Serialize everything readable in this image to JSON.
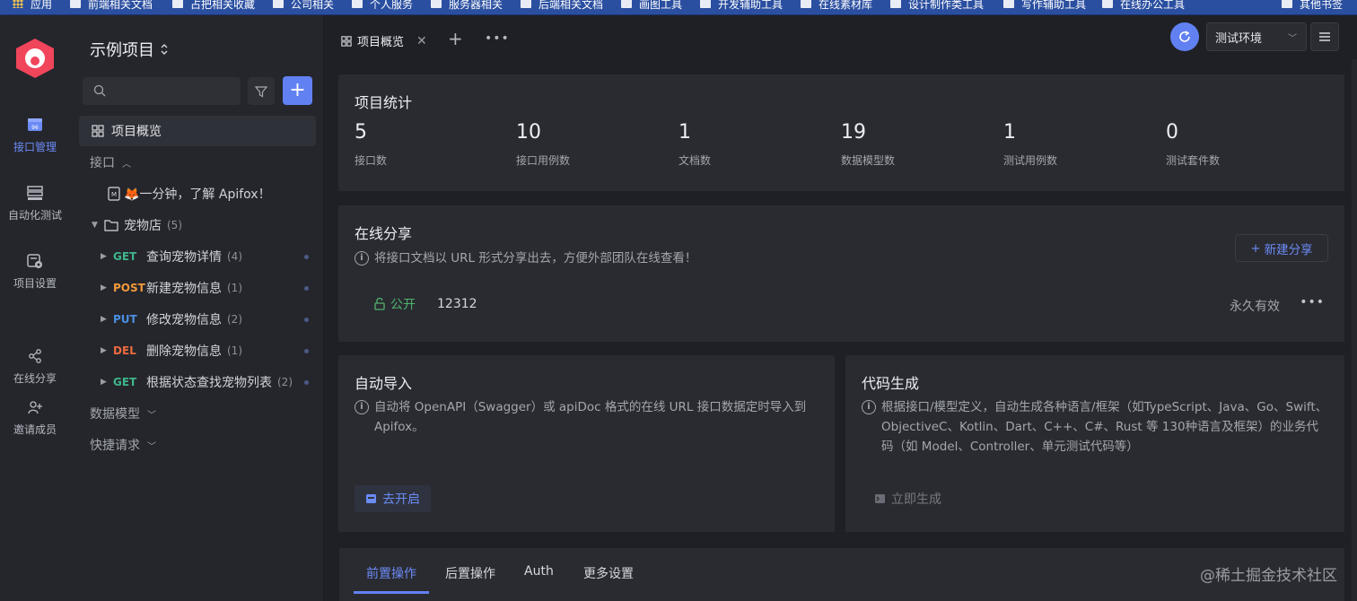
{
  "bookmarks": [
    "应用",
    "前端相关文档",
    "占把相关收藏",
    "公司相关",
    "个人服务",
    "服务器相关",
    "后端相关文档",
    "画图工具",
    "开发辅助工具",
    "在线素材库",
    "设计制作类工具",
    "写作辅助工具",
    "在线办公工具",
    "其他书签"
  ],
  "rail": {
    "api_mgmt": "接口管理",
    "auto_test": "自动化测试",
    "settings": "项目设置",
    "share": "在线分享",
    "invite": "邀请成员"
  },
  "sidebar": {
    "project_title": "示例项目",
    "overview": "项目概览",
    "api_section": "接口",
    "quick_doc": "🦊一分钟，了解 Apifox！",
    "folder": {
      "name": "宠物店",
      "count": "(5)"
    },
    "apis": [
      {
        "method": "GET",
        "name": "查询宠物详情",
        "count": "(4)"
      },
      {
        "method": "POST",
        "name": "新建宠物信息",
        "count": "(1)"
      },
      {
        "method": "PUT",
        "name": "修改宠物信息",
        "count": "(2)"
      },
      {
        "method": "DEL",
        "name": "删除宠物信息",
        "count": "(1)"
      },
      {
        "method": "GET",
        "name": "根据状态查找宠物列表",
        "count": "(2)"
      }
    ],
    "data_models": "数据模型",
    "quick_requests": "快捷请求"
  },
  "tabs": {
    "active_tab": "项目概览",
    "environment": "测试环境"
  },
  "stats": {
    "title": "项目统计",
    "items": [
      {
        "value": "5",
        "label": "接口数"
      },
      {
        "value": "10",
        "label": "接口用例数"
      },
      {
        "value": "1",
        "label": "文档数"
      },
      {
        "value": "19",
        "label": "数据模型数"
      },
      {
        "value": "1",
        "label": "测试用例数"
      },
      {
        "value": "0",
        "label": "测试套件数"
      }
    ]
  },
  "share": {
    "title": "在线分享",
    "desc": "将接口文档以 URL 形式分享出去，方便外部团队在线查看！",
    "new_button": "新建分享",
    "item": {
      "visibility": "公开",
      "name": "12312",
      "expiry": "永久有效"
    }
  },
  "auto_import": {
    "title": "自动导入",
    "desc": "自动将 OpenAPI（Swagger）或 apiDoc 格式的在线 URL 接口数据定时导入到 Apifox。",
    "button": "去开启"
  },
  "codegen": {
    "title": "代码生成",
    "desc": "根据接口/模型定义，自动生成各种语言/框架（如TypeScript、Java、Go、Swift、ObjectiveC、Kotlin、Dart、C++、C#、Rust 等 130种语言及框架）的业务代码（如 Model、Controller、单元测试代码等）",
    "button": "立即生成"
  },
  "bottom_tabs": [
    "前置操作",
    "后置操作",
    "Auth",
    "更多设置"
  ],
  "watermark": "@稀土掘金技术社区"
}
